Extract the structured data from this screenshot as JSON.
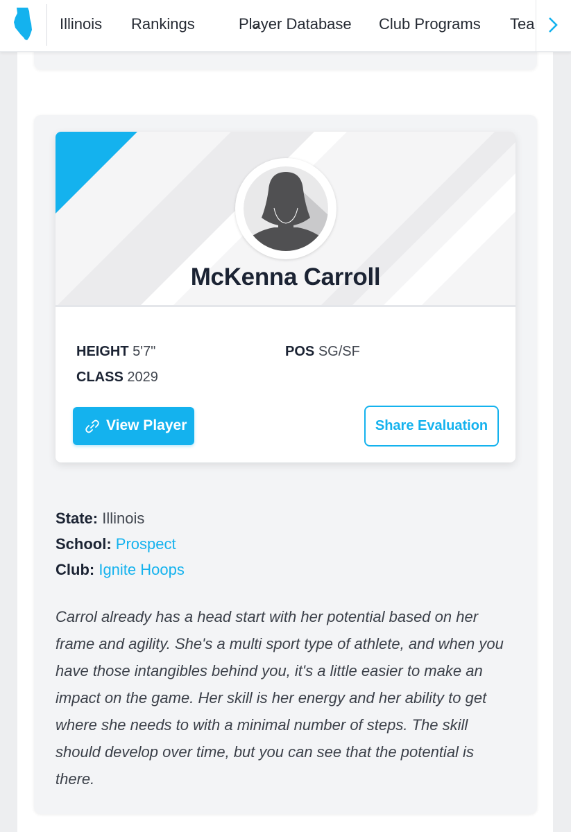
{
  "nav": {
    "items": [
      "Illinois",
      "Rankings",
      "Player Database",
      "Club Programs",
      "Tea"
    ],
    "logo_icon": "illinois-state-icon",
    "dropdown_icon": "chevron-down-icon",
    "scroll_icon": "chevron-right-icon"
  },
  "player": {
    "name": "McKenna Carroll",
    "height_label": "HEIGHT",
    "height": "5'7\"",
    "class_label": "CLASS",
    "class_year": "2029",
    "pos_label": "POS",
    "position": "SG/SF",
    "view_button": "View Player",
    "share_button": "Share Evaluation",
    "avatar_icon": "player-silhouette-icon"
  },
  "details": {
    "state_label": "State:",
    "state": "Illinois",
    "school_label": "School:",
    "school": "Prospect",
    "club_label": "Club:",
    "club": "Ignite Hoops"
  },
  "evaluation": "Carrol already has a head start with her potential based on her frame and agility. She's a multi sport type of athlete, and when you have those intangibles behind you, it's a little easier to make an impact on the game. Her skill is her energy and her ability to get where she needs to with a minimal number of steps. The skill should develop over time, but you can see that the potential is there.",
  "colors": {
    "accent": "#14b2ee",
    "text": "#1b2333",
    "card_bg": "#f3f4f6"
  }
}
